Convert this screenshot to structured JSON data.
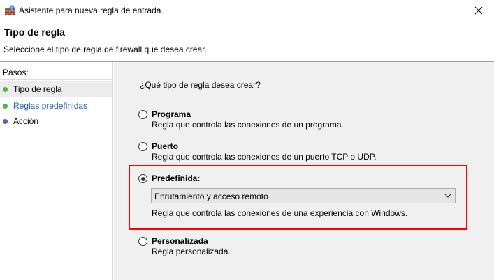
{
  "window": {
    "title": "Asistente para nueva regla de entrada",
    "close_icon": "close-icon"
  },
  "header": {
    "title": "Tipo de regla",
    "description": "Seleccione el tipo de regla de firewall que desea crear."
  },
  "sidebar": {
    "steps_label": "Pasos:",
    "steps": [
      {
        "label": "Tipo de regla",
        "dot_color": "#4cba3c",
        "active": true
      },
      {
        "label": "Reglas predefinidas",
        "dot_color": "#4cba3c",
        "active": false
      },
      {
        "label": "Acción",
        "dot_color": "#5a5ac8",
        "active": false
      }
    ]
  },
  "main": {
    "question": "¿Qué tipo de regla desea crear?",
    "options": [
      {
        "label": "Programa",
        "description": "Regla que controla las conexiones de un programa.",
        "checked": false
      },
      {
        "label": "Puerto",
        "description": "Regla que controla las conexiones de un puerto TCP o UDP.",
        "checked": false
      },
      {
        "label": "Predefinida:",
        "description": "Regla que controla las conexiones de una experiencia con Windows.",
        "checked": true
      },
      {
        "label": "Personalizada",
        "description": "Regla personalizada.",
        "checked": false
      }
    ],
    "predefined_select": {
      "value": "Enrutamiento y acceso remoto"
    }
  },
  "colors": {
    "highlight": "#ff0000",
    "link": "#1b62b6"
  }
}
